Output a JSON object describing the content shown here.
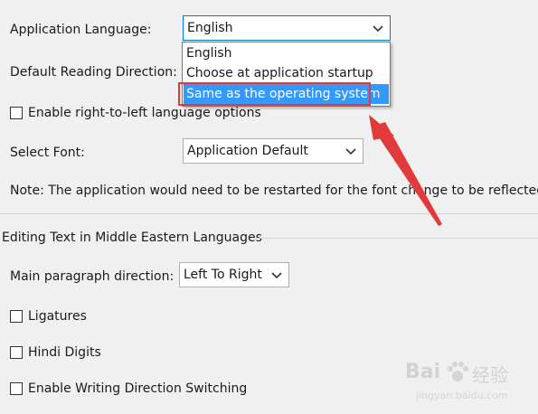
{
  "language": {
    "label": "Application Language:",
    "selected": "English",
    "options": [
      "English",
      "Choose at application startup",
      "Same as the operating system"
    ]
  },
  "reading_direction": {
    "label": "Default Reading Direction:"
  },
  "rtl_option": {
    "label": "Enable right-to-left language options",
    "checked": false
  },
  "font": {
    "label": "Select Font:",
    "selected": "Application Default"
  },
  "note": "Note: The application would need to be restarted for the font change to be reflected.",
  "middle_eastern": {
    "section_title": "Editing Text in Middle Eastern Languages",
    "paragraph_label": "Main paragraph direction:",
    "paragraph_value": "Left To Right",
    "ligatures_label": "Ligatures",
    "hindi_digits_label": "Hindi Digits",
    "writing_switch_label": "Enable Writing Direction Switching"
  },
  "watermark": {
    "brand": "Bai",
    "brand2": "经验",
    "url": "jingyan.baidu.com"
  },
  "colors": {
    "background": "#f0f0f0",
    "highlight": "#3399ff",
    "annotation_red": "#e03a3a",
    "focus_border": "#0078d7"
  }
}
